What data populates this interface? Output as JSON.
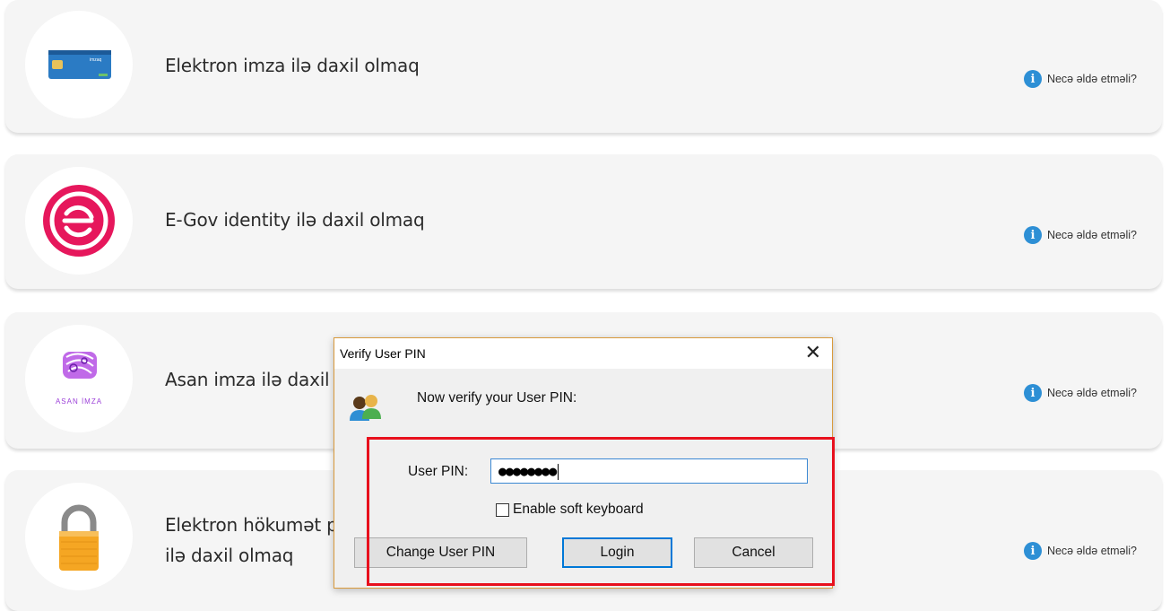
{
  "cards": [
    {
      "title": "Elektron imza ilə daxil olmaq",
      "help": "Necə əldə etməli?",
      "logo": "e-signature-card-logo",
      "card_text": "imzaq"
    },
    {
      "title": "E-Gov identity ilə daxil olmaq",
      "help": "Necə əldə etməli?",
      "logo": "egov-logo"
    },
    {
      "title": "Asan imza ilə daxil olmaq",
      "help": "Necə əldə etməli?",
      "logo": "asan-imza-logo",
      "logo_caption": "ASAN İMZA"
    },
    {
      "title_line1": "Elektron hökumət portalından alınmış istifadəçi adı və şifrə",
      "title_line2": "ilə daxil olmaq",
      "help": "Necə əldə etməli?",
      "logo": "padlock-icon"
    }
  ],
  "colors": {
    "info_blue": "#2d8fd5",
    "egov_pink": "#e6175c",
    "asan_purple": "#9b3fd8",
    "highlight_red": "#e8101d",
    "dialog_border": "#d99a3c"
  },
  "dialog": {
    "title": "Verify User PIN",
    "prompt": "Now verify your User PIN:",
    "pin_label": "User PIN:",
    "pin_value": "●●●●●●●●",
    "checkbox_label": "Enable soft keyboard",
    "checkbox_checked": false,
    "btn_change": "Change User PIN",
    "btn_login": "Login",
    "btn_cancel": "Cancel"
  }
}
